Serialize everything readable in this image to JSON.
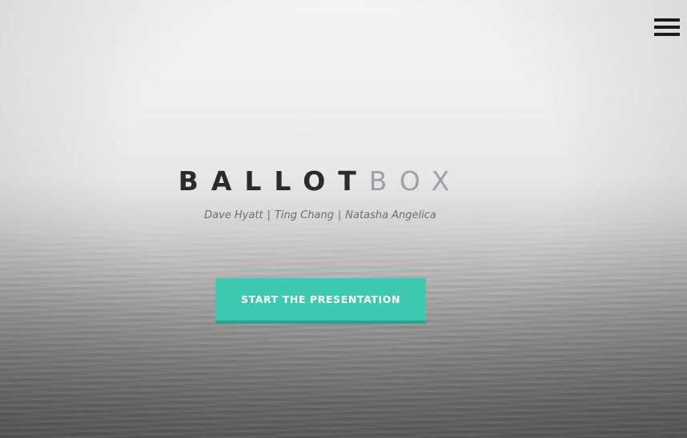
{
  "nav": {
    "menu_icon": "hamburger-icon"
  },
  "hero": {
    "title_part1": "BALLOT",
    "title_part2": "BOX",
    "authors": [
      "Dave Hyatt",
      "Ting Chang",
      "Natasha Angelica"
    ],
    "separator": "|",
    "cta_label": "START THE PRESENTATION"
  },
  "colors": {
    "accent": "#3ec9b0",
    "accent_shadow": "#2ba48e",
    "title_dark": "#2b2b2b",
    "title_light": "#9ea1a6"
  }
}
